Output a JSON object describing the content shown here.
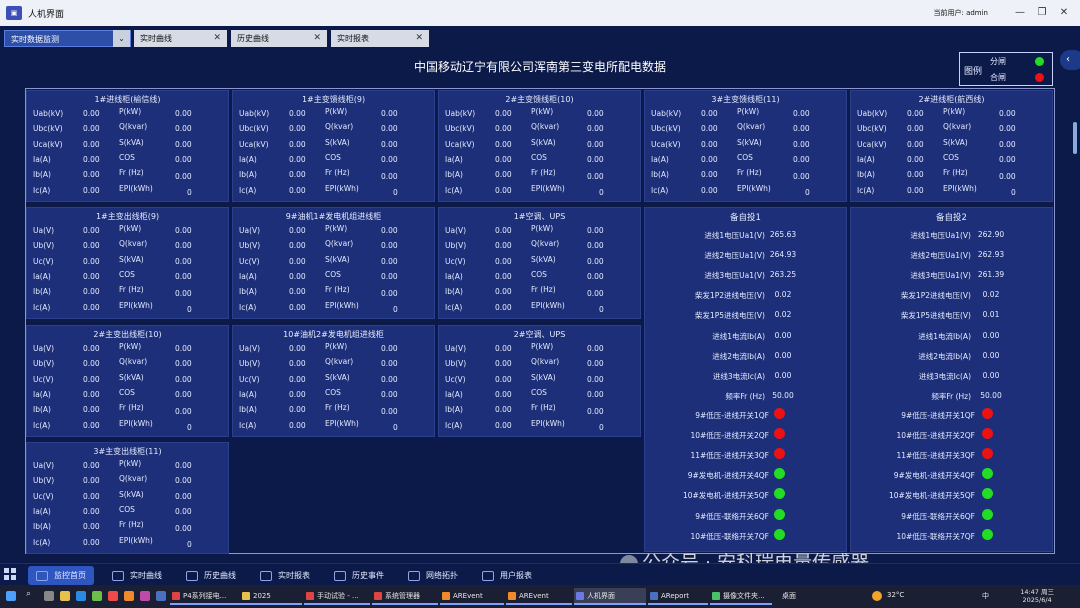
{
  "window": {
    "title": "人机界面",
    "current_user_label": "当前用户:",
    "current_user": "admin"
  },
  "tabs": [
    {
      "label": "实时数据监测",
      "active": true
    },
    {
      "label": "实时曲线"
    },
    {
      "label": "历史曲线"
    },
    {
      "label": "实时报表"
    }
  ],
  "page_title": "中国移动辽宁有限公司浑南第三变电所配电数据",
  "legend": {
    "title": "图例",
    "items": [
      {
        "label": "分闸",
        "color": "#22dd22"
      },
      {
        "label": "合闸",
        "color": "#ee1111"
      }
    ]
  },
  "panels_row1": [
    {
      "title": "1#进线柜(榆信线)",
      "v1": "Uab(kV)",
      "v2": "Ubc(kV)",
      "v3": "Uca(kV)"
    },
    {
      "title": "1#主变馈线柜(9)",
      "v1": "Uab(kV)",
      "v2": "Ubc(kV)",
      "v3": "Uca(kV)"
    },
    {
      "title": "2#主变馈线柜(10)",
      "v1": "Uab(kV)",
      "v2": "Ubc(kV)",
      "v3": "Uca(kV)"
    },
    {
      "title": "3#主变馈线柜(11)",
      "v1": "Uab(kV)",
      "v2": "Ubc(kV)",
      "v3": "Uca(kV)"
    },
    {
      "title": "2#进线柜(航西线)",
      "v1": "Uab(kV)",
      "v2": "Ubc(kV)",
      "v3": "Uca(kV)"
    }
  ],
  "panels_lower": [
    {
      "title": "1#主变出线柜(9)"
    },
    {
      "title": "9#油机1#发电机组进线柜"
    },
    {
      "title": "1#空调、UPS"
    },
    {
      "title": "2#主变出线柜(10)"
    },
    {
      "title": "10#油机2#发电机组进线柜"
    },
    {
      "title": "2#空调、UPS"
    },
    {
      "title": "3#主变出线柜(11)"
    }
  ],
  "lower_labels": {
    "v1": "Ua(V)",
    "v2": "Ub(V)",
    "v3": "Uc(V)"
  },
  "common_labels": {
    "i1": "Ia(A)",
    "i2": "Ib(A)",
    "i3": "Ic(A)",
    "p": "P(kW)",
    "q": "Q(kvar)",
    "s": "S(kVA)",
    "cos": "COS",
    "fr": "Fr (Hz)",
    "epi": "EPI(kWh)"
  },
  "common_values": {
    "v": "0.00",
    "epi": "0"
  },
  "backup": [
    {
      "title": "备自投1",
      "rows": [
        {
          "label": "进线1电压Ua1(V)",
          "value": "265.63"
        },
        {
          "label": "进线2电压Ua1(V)",
          "value": "264.93"
        },
        {
          "label": "进线3电压Ua1(V)",
          "value": "263.25"
        },
        {
          "label": "柴发1P2进线电压(V)",
          "value": "0.02"
        },
        {
          "label": "柴发1P5进线电压(V)",
          "value": "0.02"
        },
        {
          "label": "进线1电流Ib(A)",
          "value": "0.00"
        },
        {
          "label": "进线2电流Ib(A)",
          "value": "0.00"
        },
        {
          "label": "进线3电流Ic(A)",
          "value": "0.00"
        },
        {
          "label": "频率Fr (Hz)",
          "value": "50.00"
        }
      ],
      "switches": [
        {
          "label": "9#低压-进线开关1QF",
          "color": "#ee1111"
        },
        {
          "label": "10#低压-进线开关2QF",
          "color": "#ee1111"
        },
        {
          "label": "11#低压-进线开关3QF",
          "color": "#ee1111"
        },
        {
          "label": "9#发电机-进线开关4QF",
          "color": "#22dd22"
        },
        {
          "label": "10#发电机-进线开关5QF",
          "color": "#22dd22"
        },
        {
          "label": "9#低压-联络开关6QF",
          "color": "#22dd22"
        },
        {
          "label": "10#低压-联络开关7QF",
          "color": "#22dd22"
        }
      ]
    },
    {
      "title": "备自投2",
      "rows": [
        {
          "label": "进线1电压Ua1(V)",
          "value": "262.90"
        },
        {
          "label": "进线2电压Ua1(V)",
          "value": "262.93"
        },
        {
          "label": "进线3电压Ua1(V)",
          "value": "261.39"
        },
        {
          "label": "柴发1P2进线电压(V)",
          "value": "0.02"
        },
        {
          "label": "柴发1P5进线电压(V)",
          "value": "0.01"
        },
        {
          "label": "进线1电流Ib(A)",
          "value": "0.00"
        },
        {
          "label": "进线2电流Ib(A)",
          "value": "0.00"
        },
        {
          "label": "进线3电流Ic(A)",
          "value": "0.00"
        },
        {
          "label": "频率Fr (Hz)",
          "value": "50.00"
        }
      ],
      "switches": [
        {
          "label": "9#低压-进线开关1QF",
          "color": "#ee1111"
        },
        {
          "label": "10#低压-进线开关2QF",
          "color": "#ee1111"
        },
        {
          "label": "11#低压-进线开关3QF",
          "color": "#ee1111"
        },
        {
          "label": "9#发电机-进线开关4QF",
          "color": "#22dd22"
        },
        {
          "label": "10#发电机-进线开关5QF",
          "color": "#22dd22"
        },
        {
          "label": "9#低压-联络开关6QF",
          "color": "#22dd22"
        },
        {
          "label": "10#低压-联络开关7QF",
          "color": "#22dd22"
        }
      ]
    }
  ],
  "bottom_nav": [
    "监控首页",
    "实时曲线",
    "历史曲线",
    "实时报表",
    "历史事件",
    "网络拓扑",
    "用户报表"
  ],
  "watermark": "公众号 · 安科瑞电量传感器",
  "taskbar": {
    "items": [
      "P4系列接电...",
      "2025",
      "手动试验 - ...",
      "系统管理器",
      "AREvent",
      "AREvent",
      "人机界面",
      "AReport",
      "摄像文件夹..."
    ],
    "tray_left": "桌面",
    "weather": "32°C",
    "lang": "中",
    "time": "14:47 周三",
    "date": "2025/6/4"
  }
}
